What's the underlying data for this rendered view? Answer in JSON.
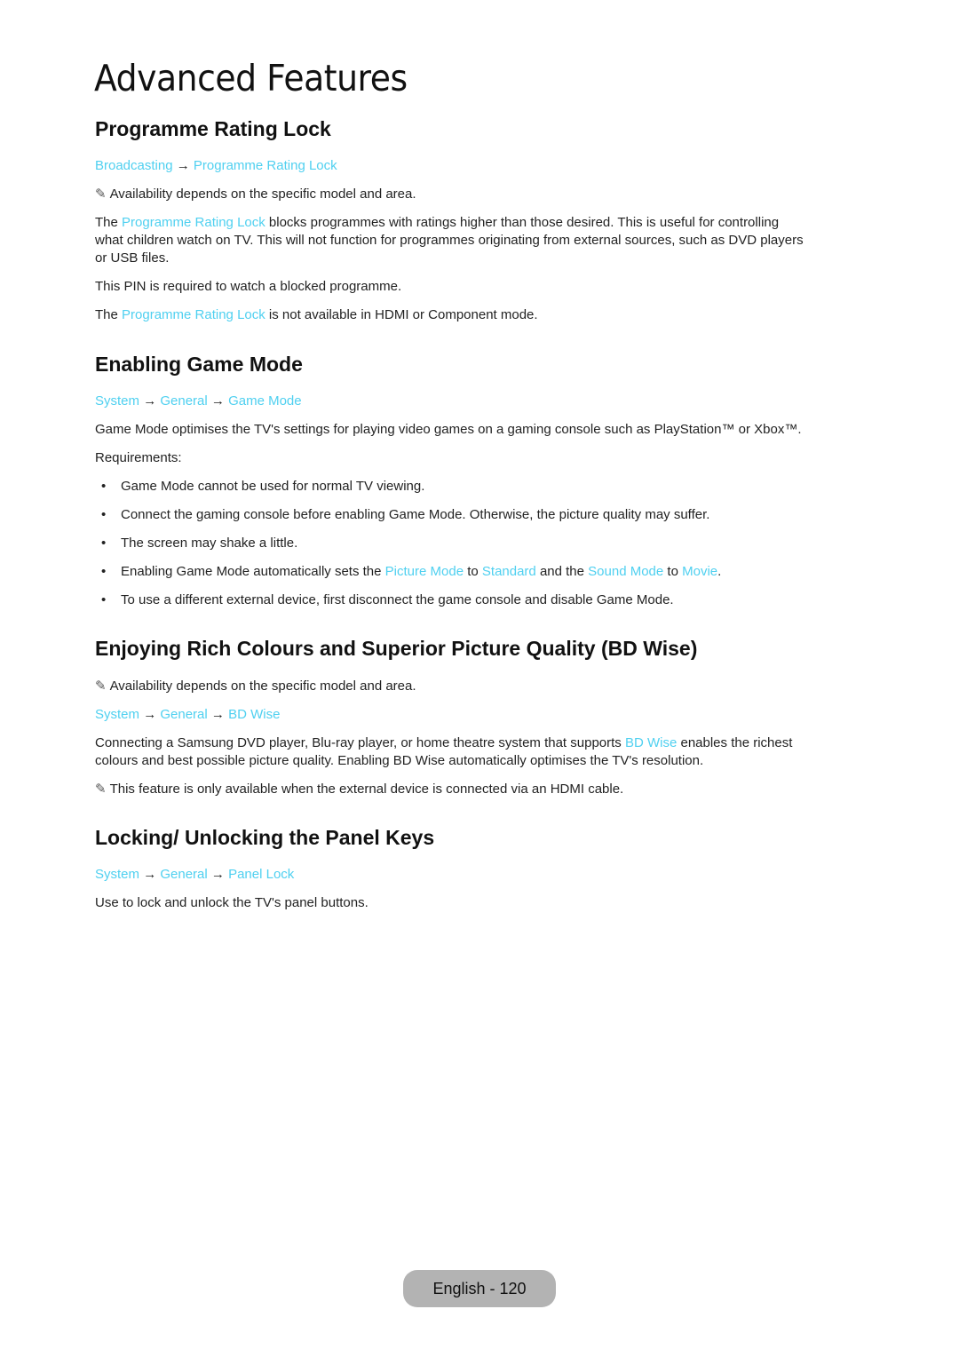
{
  "page": {
    "title": "Advanced Features",
    "footer": "English - 120"
  },
  "colors": {
    "link": "#4fd0f0",
    "footer_badge": "#b3b3b3"
  },
  "icons": {
    "note": "✎",
    "arrow": "→",
    "bullet": "•"
  },
  "sections": [
    {
      "heading": "Programme Rating Lock",
      "path": [
        "Broadcasting",
        "Programme Rating Lock"
      ],
      "note1": "Availability depends on the specific model and area.",
      "p1_pre": "The ",
      "p1_link": "Programme Rating Lock",
      "p1_post_l1": " blocks programmes with ratings higher than those desired. This is useful for controlling",
      "p1_l2": "what children watch on TV. This will not function for programmes originating from external sources, such as DVD players",
      "p1_l3": "or USB files.",
      "p2": "This PIN is required to watch a blocked programme.",
      "p3_pre": "The ",
      "p3_link": "Programme Rating Lock",
      "p3_post": " is not available in HDMI or Component mode."
    },
    {
      "heading": "Enabling Game Mode",
      "path": [
        "System",
        "General",
        "Game Mode"
      ],
      "p1": "Game Mode optimises the TV's settings for playing video games on a gaming console such as PlayStation™ or Xbox™.",
      "requirements_label": "Requirements:",
      "bullets": [
        "Game Mode cannot be used for normal TV viewing.",
        "Connect the gaming console before enabling Game Mode. Otherwise, the picture quality may suffer.",
        "The screen may shake a little."
      ],
      "bullet4": {
        "t1": "Enabling Game Mode automatically sets the ",
        "l1": "Picture Mode",
        "t2": " to ",
        "l2": "Standard",
        "t3": " and the ",
        "l3": "Sound Mode",
        "t4": " to ",
        "l4": "Movie",
        "t5": "."
      },
      "bullet5": "To use a different external device, first disconnect the game console and disable Game Mode."
    },
    {
      "heading": "Enjoying Rich Colours and Superior Picture Quality (BD Wise)",
      "note1": "Availability depends on the specific model and area.",
      "path": [
        "System",
        "General",
        "BD Wise"
      ],
      "p1_pre": "Connecting a Samsung DVD player, Blu-ray player, or home theatre system that supports ",
      "p1_link": "BD Wise",
      "p1_post": " enables the richest",
      "p1_l2": "colours and best possible picture quality. Enabling BD Wise automatically optimises the TV's resolution.",
      "note2": "This feature is only available when the external device is connected via an HDMI cable."
    },
    {
      "heading": "Locking/ Unlocking the Panel Keys",
      "path": [
        "System",
        "General",
        "Panel Lock"
      ],
      "p1": "Use to lock and unlock the TV's panel buttons."
    }
  ]
}
